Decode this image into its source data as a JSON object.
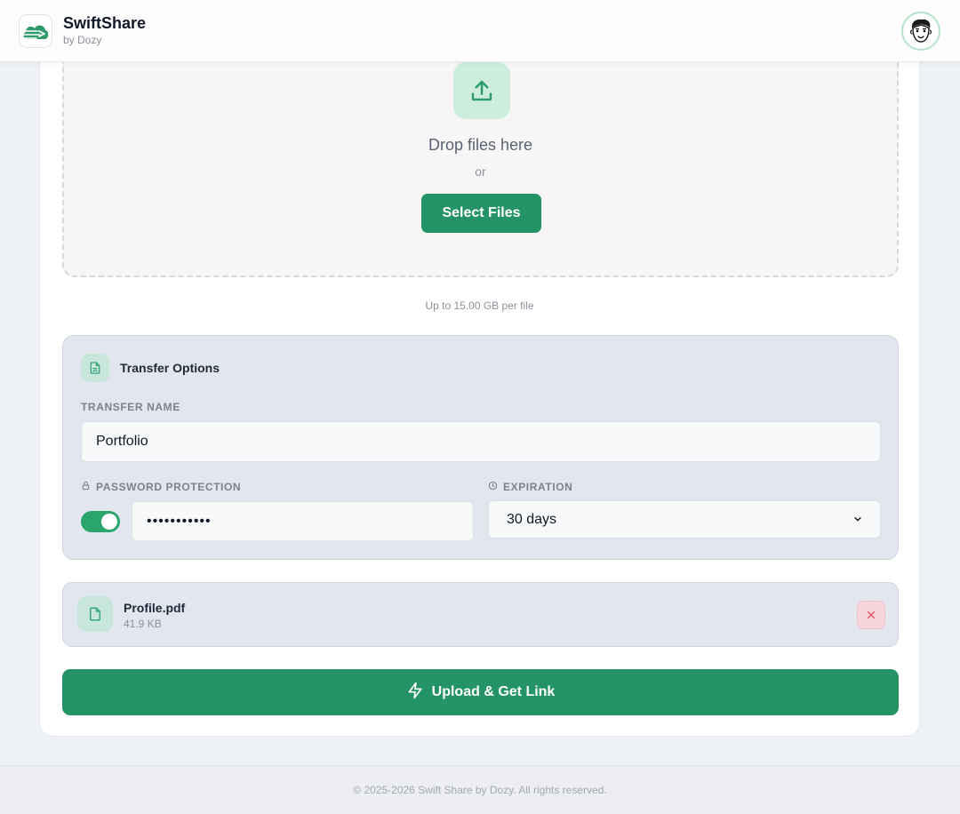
{
  "header": {
    "app_name": "SwiftShare",
    "subtitle": "by Dozy",
    "logo_icon": "cloud-arrow-icon",
    "avatar_icon": "cartoon-face-avatar"
  },
  "dropzone": {
    "icon": "upload-icon",
    "title": "Drop files here",
    "or_text": "or",
    "select_button": "Select Files",
    "limit_note": "Up to 15.00 GB per file"
  },
  "options": {
    "title": "Transfer Options",
    "icon": "document-icon",
    "transfer_name_label": "TRANSFER NAME",
    "transfer_name_value": "Portfolio",
    "password_label": "PASSWORD PROTECTION",
    "password_enabled": true,
    "password_value": "•••••••••••",
    "expiration_label": "EXPIRATION",
    "expiration_value": "30 days"
  },
  "file": {
    "name": "Profile.pdf",
    "size": "41.9 KB",
    "icon": "file-icon"
  },
  "upload_button": "Upload & Get Link",
  "footer": {
    "text": "© 2025-2026 Swift Share by Dozy. All rights reserved."
  },
  "colors": {
    "primary": "#249467",
    "primary_light": "#cdeedd",
    "danger_bg": "#f5d5d9",
    "danger": "#e0566a",
    "panel_bg": "#e2e7ef"
  }
}
